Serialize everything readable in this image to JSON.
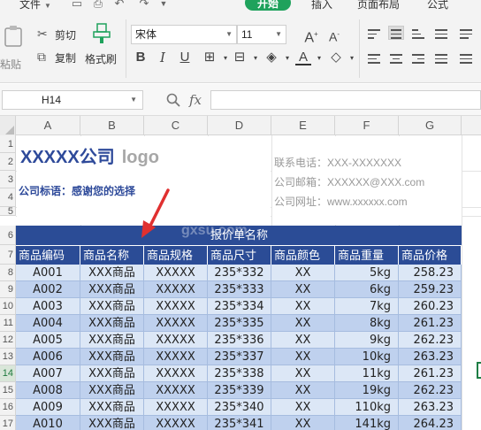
{
  "menu": {
    "file_label": "文件",
    "tabs": [
      "开始",
      "插入",
      "页面布局",
      "公式"
    ]
  },
  "ribbon": {
    "paste_label": "粘贴",
    "cut_label": "剪切",
    "copy_label": "复制",
    "format_painter_label": "格式刷",
    "font_name": "宋体",
    "font_size": "11"
  },
  "formula_bar": {
    "cell_ref": "H14",
    "fx_label": "fx",
    "formula": ""
  },
  "grid": {
    "columns": [
      "A",
      "B",
      "C",
      "D",
      "E",
      "F",
      "G"
    ],
    "rows": [
      "1",
      "2",
      "3",
      "4",
      "5",
      "6",
      "7",
      "8",
      "9",
      "10",
      "11",
      "12",
      "13",
      "14",
      "15",
      "16",
      "17"
    ],
    "active_row": "14"
  },
  "sheet": {
    "company_name": "XXXXX公司",
    "logo_text": "logo",
    "slogan": "公司标语：感谢您的选择",
    "phone": "联系电话：XXX-XXXXXXX",
    "email": "公司邮箱：XXXXXX@XXX.com",
    "website": "公司网址：www.xxxxxx.com",
    "table_title": "报价单名称",
    "headers": [
      "商品编码",
      "商品名称",
      "商品规格",
      "商品尺寸",
      "商品颜色",
      "商品重量",
      "商品价格"
    ],
    "rows": [
      [
        "A001",
        "XXX商品",
        "XXXXX",
        "235*332",
        "XX",
        "5kg",
        "258.23"
      ],
      [
        "A002",
        "XXX商品",
        "XXXXX",
        "235*333",
        "XX",
        "6kg",
        "259.23"
      ],
      [
        "A003",
        "XXX商品",
        "XXXXX",
        "235*334",
        "XX",
        "7kg",
        "260.23"
      ],
      [
        "A004",
        "XXX商品",
        "XXXXX",
        "235*335",
        "XX",
        "8kg",
        "261.23"
      ],
      [
        "A005",
        "XXX商品",
        "XXXXX",
        "235*336",
        "XX",
        "9kg",
        "262.23"
      ],
      [
        "A006",
        "XXX商品",
        "XXXXX",
        "235*337",
        "XX",
        "10kg",
        "263.23"
      ],
      [
        "A007",
        "XXX商品",
        "XXXXX",
        "235*338",
        "XX",
        "11kg",
        "261.23"
      ],
      [
        "A008",
        "XXX商品",
        "XXXXX",
        "235*339",
        "XX",
        "19kg",
        "262.23"
      ],
      [
        "A009",
        "XXX商品",
        "XXXXX",
        "235*340",
        "XX",
        "110kg",
        "263.23"
      ],
      [
        "A010",
        "XXX商品",
        "XXXXX",
        "235*341",
        "XX",
        "141kg",
        "264.23"
      ]
    ]
  },
  "colors": {
    "accent_green": "#1fa25c",
    "table_header_blue": "#2b4c96",
    "row_light": "#dce7f6",
    "row_dark": "#bfd1ee",
    "arrow_red": "#e03030"
  }
}
